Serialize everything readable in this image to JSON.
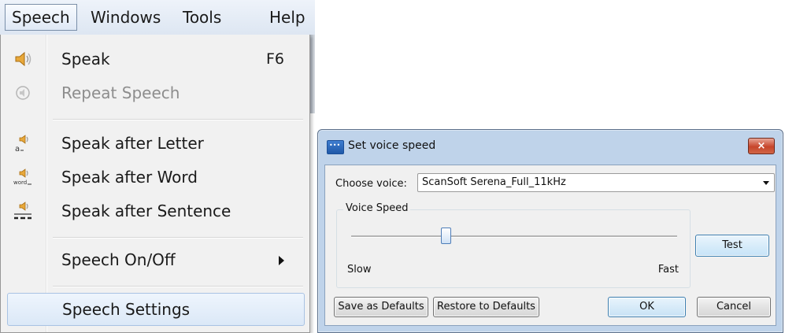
{
  "menubar": {
    "items": [
      {
        "label": "Speech"
      },
      {
        "label": "Windows"
      },
      {
        "label": "Tools"
      },
      {
        "label": "Help"
      }
    ]
  },
  "menu": {
    "items": [
      {
        "label": "Speak",
        "shortcut": "F6",
        "icon": "speaker-icon",
        "disabled": false
      },
      {
        "label": "Repeat Speech",
        "icon": "repeat-speech-icon",
        "disabled": true
      },
      {
        "label": "Speak after Letter",
        "icon": "speak-letter-icon",
        "disabled": false
      },
      {
        "label": "Speak after Word",
        "icon": "speak-word-icon",
        "disabled": false
      },
      {
        "label": "Speak after Sentence",
        "icon": "speak-sentence-icon",
        "disabled": false
      },
      {
        "label": "Speech On/Off",
        "submenu": true,
        "disabled": false
      },
      {
        "label": "Speech Settings",
        "highlighted": true,
        "disabled": false
      }
    ]
  },
  "dialog": {
    "title": "Set voice speed",
    "close_label": "×",
    "choose_voice_label": "Choose voice:",
    "voice_value": "ScanSoft Serena_Full_11kHz",
    "voice_speed_legend": "Voice Speed",
    "slider": {
      "min_label": "Slow",
      "max_label": "Fast",
      "value_fraction": 0.29
    },
    "buttons": {
      "test": "Test",
      "save_defaults": "Save as Defaults",
      "restore_defaults": "Restore to Defaults",
      "ok": "OK",
      "cancel": "Cancel"
    }
  },
  "colors": {
    "dialog_frame": "#bfd3ea",
    "close_button": "#c7452b",
    "highlight": "#dbe8f7",
    "speaker_icon": "#e8a83a"
  }
}
